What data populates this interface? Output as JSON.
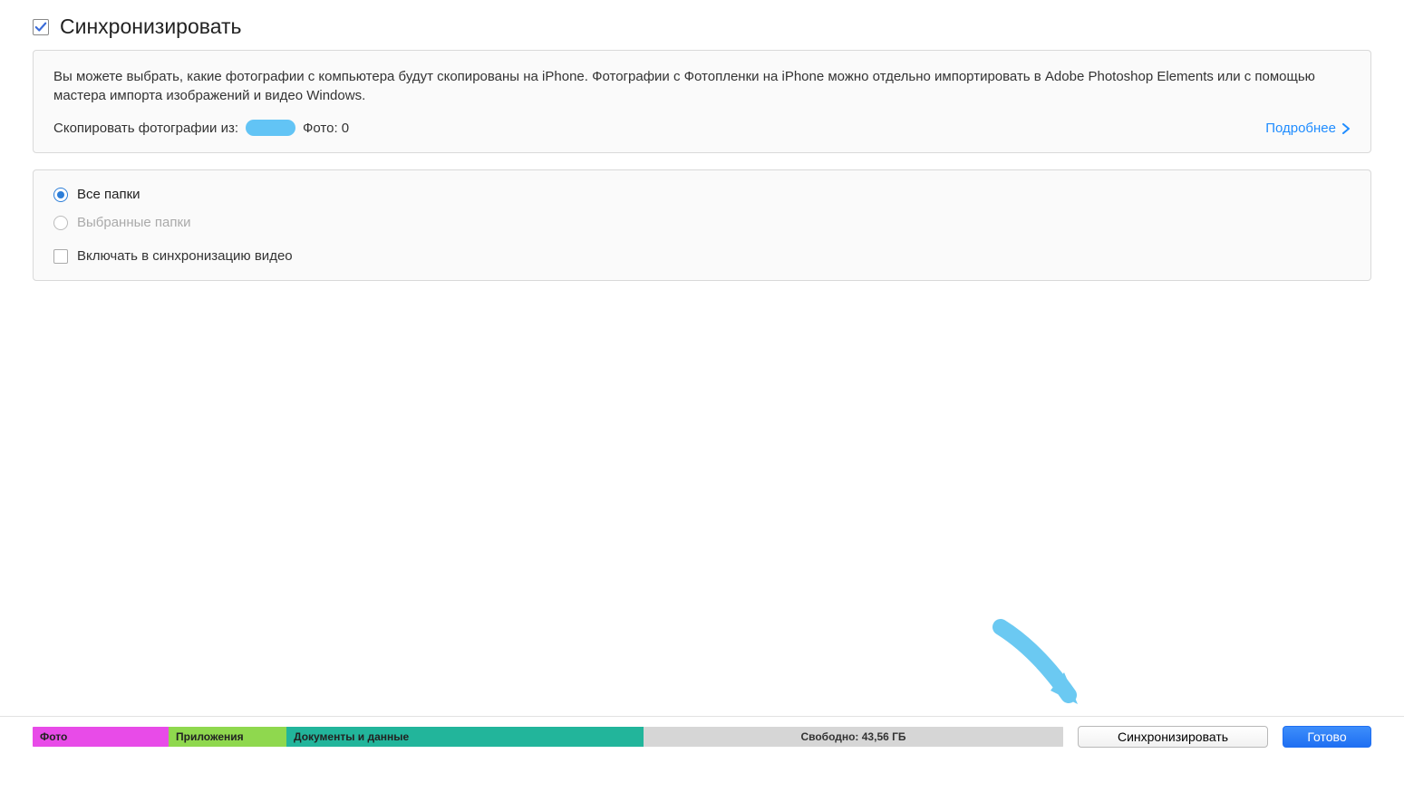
{
  "header": {
    "title": "Синхронизировать",
    "checked": true
  },
  "info": {
    "description": "Вы можете выбрать, какие фотографии с компьютера будут скопированы на iPhone. Фотографии с Фотопленки на iPhone можно отдельно импортировать в Adobe Photoshop Elements или с помощью мастера импорта изображений и видео Windows.",
    "source_prefix": "Скопировать фотографии из:",
    "photo_count_label": "Фото: 0",
    "learn_more": "Подробнее"
  },
  "options": {
    "all_folders": "Все папки",
    "selected_folders": "Выбранные папки",
    "include_video": "Включать в синхронизацию видео"
  },
  "footer": {
    "segments": {
      "photo": "Фото",
      "apps": "Приложения",
      "docs": "Документы и данные",
      "free": "Свободно: 43,56 ГБ"
    },
    "sync_button": "Синхронизировать",
    "done_button": "Готово"
  }
}
